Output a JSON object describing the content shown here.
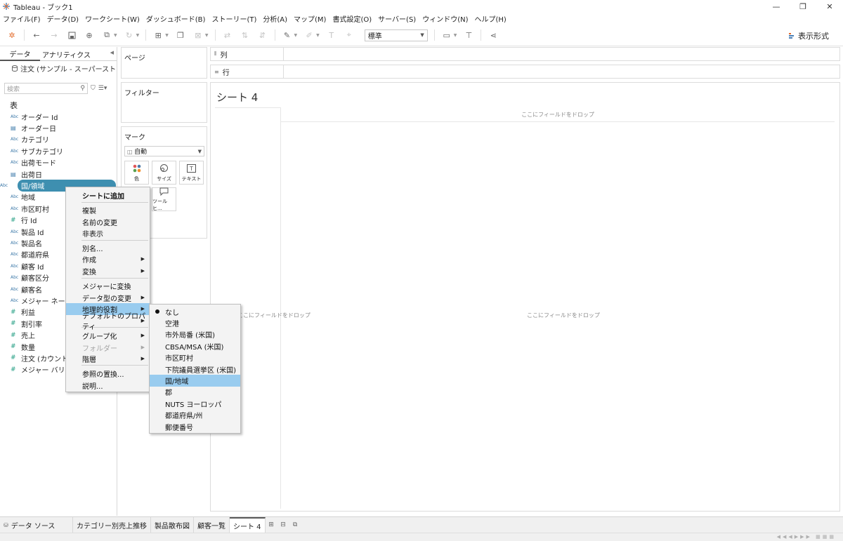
{
  "window": {
    "title": "Tableau - ブック1",
    "minimize": "—",
    "restore": "❐",
    "close": "✕"
  },
  "menu": [
    "ファイル(F)",
    "データ(D)",
    "ワークシート(W)",
    "ダッシュボード(B)",
    "ストーリー(T)",
    "分析(A)",
    "マップ(M)",
    "書式設定(O)",
    "サーバー(S)",
    "ウィンドウ(N)",
    "ヘルプ(H)"
  ],
  "toolbar": {
    "fit": "標準",
    "show_me": "表示形式"
  },
  "data_pane": {
    "tabs": [
      "データ",
      "アナリティクス"
    ],
    "datasource": "注文 (サンプル - スーパーストア...",
    "search_placeholder": "検索",
    "table_header": "表",
    "fields": [
      {
        "name": "オーダー Id",
        "type": "Abc"
      },
      {
        "name": "オーダー日",
        "type": "date"
      },
      {
        "name": "カテゴリ",
        "type": "Abc"
      },
      {
        "name": "サブカテゴリ",
        "type": "Abc"
      },
      {
        "name": "出荷モード",
        "type": "Abc"
      },
      {
        "name": "出荷日",
        "type": "date"
      },
      {
        "name": "国/領域",
        "type": "Abc",
        "selected": true
      },
      {
        "name": "地域",
        "type": "Abc"
      },
      {
        "name": "市区町村",
        "type": "Abc"
      },
      {
        "name": "行 Id",
        "type": "#"
      },
      {
        "name": "製品 Id",
        "type": "Abc"
      },
      {
        "name": "製品名",
        "type": "Abc"
      },
      {
        "name": "都道府県",
        "type": "Abc"
      },
      {
        "name": "顧客 Id",
        "type": "Abc"
      },
      {
        "name": "顧客区分",
        "type": "Abc"
      },
      {
        "name": "顧客名",
        "type": "Abc"
      },
      {
        "name": "メジャー ネーム",
        "type": "Abc"
      },
      {
        "name": "利益",
        "type": "#"
      },
      {
        "name": "割引率",
        "type": "#"
      },
      {
        "name": "売上",
        "type": "#"
      },
      {
        "name": "数量",
        "type": "#"
      },
      {
        "name": "注文 (カウント)",
        "type": "#"
      },
      {
        "name": "メジャー バリュー",
        "type": "#"
      }
    ]
  },
  "cards": {
    "pages": "ページ",
    "filters": "フィルター",
    "marks": "マーク",
    "mark_type": "自動",
    "mark_buttons": [
      "色",
      "サイズ",
      "テキスト",
      "ツールヒ..."
    ]
  },
  "shelves": {
    "columns": "列",
    "rows": "行"
  },
  "view": {
    "sheet_title": "シート 4",
    "drop_hint": "ここにフィールドをドロップ"
  },
  "context_menu": {
    "items": [
      {
        "label": "シートに追加",
        "bold": true
      },
      {
        "label": "複製"
      },
      {
        "label": "名前の変更"
      },
      {
        "label": "非表示"
      },
      {
        "label": "別名..."
      },
      {
        "label": "作成",
        "submenu": true
      },
      {
        "label": "変換",
        "submenu": true
      },
      {
        "label": "メジャーに変換"
      },
      {
        "label": "データ型の変更",
        "submenu": true
      },
      {
        "label": "地理的役割",
        "submenu": true,
        "highlight": true
      },
      {
        "label": "デフォルトのプロパティ",
        "submenu": true
      },
      {
        "label": "グループ化",
        "submenu": true
      },
      {
        "label": "フォルダー",
        "submenu": true,
        "disabled": true
      },
      {
        "label": "階層",
        "submenu": true
      },
      {
        "label": "参照の置換..."
      },
      {
        "label": "説明..."
      }
    ]
  },
  "geo_submenu": {
    "items": [
      {
        "label": "なし",
        "checked": true
      },
      {
        "label": "空港"
      },
      {
        "label": "市外局番 (米国)"
      },
      {
        "label": "CBSA/MSA (米国)"
      },
      {
        "label": "市区町村"
      },
      {
        "label": "下院議員選挙区 (米国)"
      },
      {
        "label": "国/地域",
        "highlight": true
      },
      {
        "label": "郡"
      },
      {
        "label": "NUTS ヨーロッパ"
      },
      {
        "label": "都道府県/州"
      },
      {
        "label": "郵便番号"
      }
    ]
  },
  "bottom_tabs": {
    "datasource": "データ ソース",
    "sheets": [
      "カテゴリー別売上推移",
      "製品散布図",
      "顧客一覧",
      "シート 4"
    ],
    "active": "シート 4"
  },
  "colors": {
    "selected_pill": "#3e8fb0",
    "menu_highlight": "#99ccef",
    "measure": "#1f9c80",
    "dimension": "#3b78a8"
  }
}
